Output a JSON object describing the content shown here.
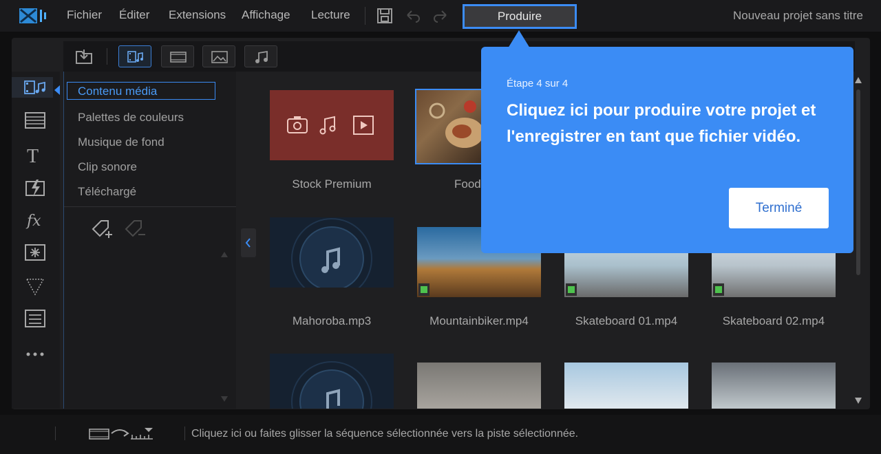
{
  "app": {
    "menu": [
      "Fichier",
      "Éditer",
      "Extensions",
      "Affichage",
      "Lecture"
    ],
    "produce_label": "Produire",
    "project_title": "Nouveau projet sans titre"
  },
  "library": {
    "folders": [
      "Contenu média",
      "Palettes de couleurs",
      "Musique de fond",
      "Clip sonore",
      "Téléchargé"
    ],
    "items": [
      {
        "caption": "Stock Premium"
      },
      {
        "caption": "Food"
      },
      {
        "caption": "Mahoroba.mp3"
      },
      {
        "caption": "Mountainbiker.mp4"
      },
      {
        "caption": "Skateboard 01.mp4"
      },
      {
        "caption": "Skateboard 02.mp4"
      }
    ]
  },
  "tour": {
    "step": "Étape 4 sur 4",
    "text": "Cliquez ici pour produire votre projet et l'enregistrer en tant que fichier vidéo.",
    "done_label": "Terminé"
  },
  "status": {
    "hint": "Cliquez ici ou faites glisser la séquence sélectionnée vers la piste sélectionnée."
  },
  "colors": {
    "accent": "#3b8cf5",
    "popover": "#3b8cf5",
    "stock_tile": "#7a2e2a",
    "video_badge": "#4ec24e"
  }
}
